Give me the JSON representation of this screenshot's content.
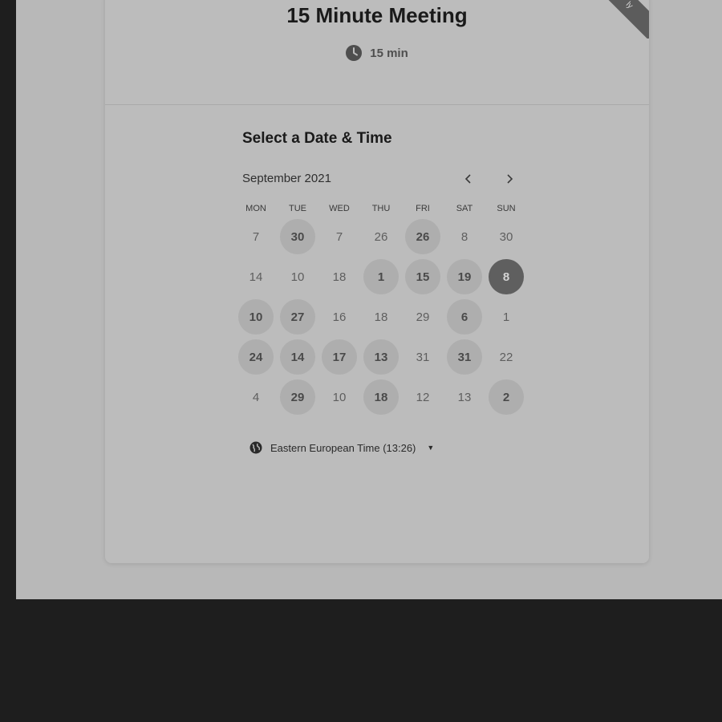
{
  "header": {
    "title": "15 Minute Meeting",
    "duration": "15 min",
    "ribbon_text": "ly"
  },
  "scheduler": {
    "section_title": "Select a Date & Time",
    "month": "September 2021",
    "weekdays": [
      "MON",
      "TUE",
      "WED",
      "THU",
      "FRI",
      "SAT",
      "SUN"
    ],
    "weeks": [
      [
        {
          "d": "7",
          "s": "off"
        },
        {
          "d": "30",
          "s": "avail"
        },
        {
          "d": "7",
          "s": "off"
        },
        {
          "d": "26",
          "s": "off"
        },
        {
          "d": "26",
          "s": "avail"
        },
        {
          "d": "8",
          "s": "off"
        },
        {
          "d": "30",
          "s": "off"
        }
      ],
      [
        {
          "d": "14",
          "s": "off"
        },
        {
          "d": "10",
          "s": "off"
        },
        {
          "d": "18",
          "s": "off"
        },
        {
          "d": "1",
          "s": "avail"
        },
        {
          "d": "15",
          "s": "avail"
        },
        {
          "d": "19",
          "s": "avail"
        },
        {
          "d": "8",
          "s": "selected"
        }
      ],
      [
        {
          "d": "10",
          "s": "avail"
        },
        {
          "d": "27",
          "s": "avail"
        },
        {
          "d": "16",
          "s": "off"
        },
        {
          "d": "18",
          "s": "off"
        },
        {
          "d": "29",
          "s": "off"
        },
        {
          "d": "6",
          "s": "avail"
        },
        {
          "d": "1",
          "s": "off"
        }
      ],
      [
        {
          "d": "24",
          "s": "avail"
        },
        {
          "d": "14",
          "s": "avail"
        },
        {
          "d": "17",
          "s": "avail"
        },
        {
          "d": "13",
          "s": "avail"
        },
        {
          "d": "31",
          "s": "off"
        },
        {
          "d": "31",
          "s": "avail"
        },
        {
          "d": "22",
          "s": "off"
        }
      ],
      [
        {
          "d": "4",
          "s": "off"
        },
        {
          "d": "29",
          "s": "avail"
        },
        {
          "d": "10",
          "s": "off"
        },
        {
          "d": "18",
          "s": "avail"
        },
        {
          "d": "12",
          "s": "off"
        },
        {
          "d": "13",
          "s": "off"
        },
        {
          "d": "2",
          "s": "avail"
        }
      ]
    ],
    "timezone": "Eastern European Time (13:26)"
  },
  "icons": {
    "duration": "clock-icon",
    "prev": "chevron-left-icon",
    "next": "chevron-right-icon",
    "timezone": "globe-icon",
    "dropdown": "caret-down-icon"
  },
  "colors": {
    "page_background": "#1e1e1e",
    "card_background": "#bcbcbc",
    "available_day": "#aeaeae",
    "selected_day": "#5f5f5f"
  }
}
